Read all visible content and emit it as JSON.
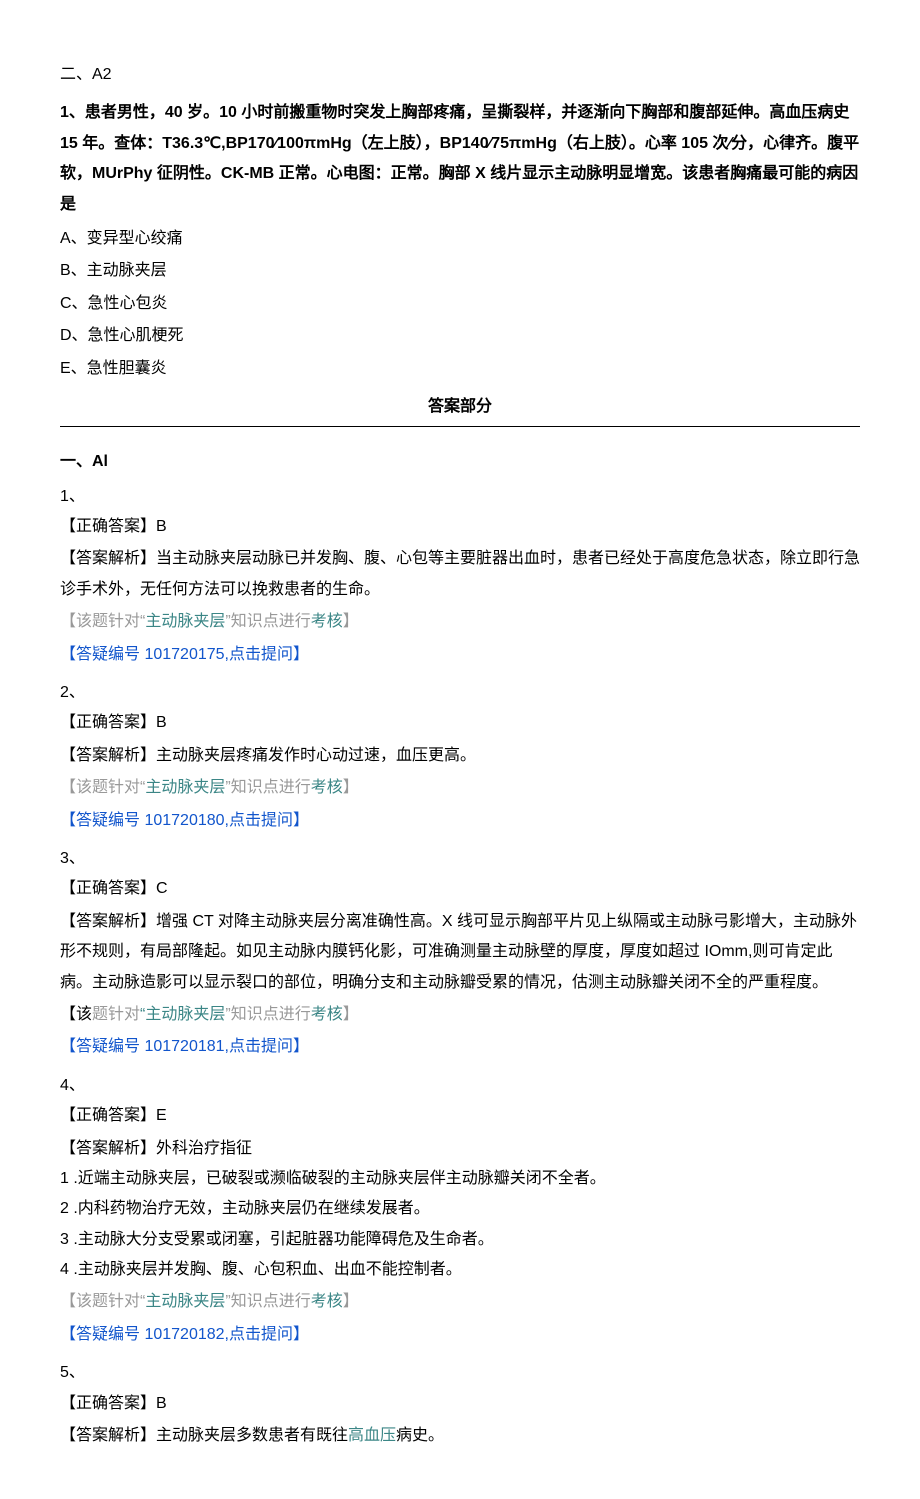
{
  "section2": {
    "header": "二、A2",
    "q1": {
      "num": "1、",
      "stem": "患者男性，40 岁。10 小时前搬重物时突发上胸部疼痛，呈撕裂样，并逐渐向下胸部和腹部延伸。高血压病史 15 年。查体：T36.3℃,BP170⁄100πmHg（左上肢），BP140⁄75πmHg（右上肢）。心率 105 次∕分，心律齐。腹平软，MUrPhy 征阴性。CK-MB 正常。心电图：正常。胸部 X 线片显示主动脉明显增宽。该患者胸痛最可能的病因是",
      "options": {
        "A": "A、变异型心绞痛",
        "B": "B、主动脉夹层",
        "C": "C、急性心包炎",
        "D": "D、急性心肌梗死",
        "E": "E、急性胆囊炎"
      }
    }
  },
  "answerTitle": "答案部分",
  "answerSection": {
    "header": "一、Al",
    "items": [
      {
        "num": "1、",
        "correct": "【正确答案】B",
        "explain": "【答案解析】当主动脉夹层动脉已并发胸、腹、心包等主要脏器出血时，患者已经处于高度危急状态，除立即行急诊手术外，无任何方法可以挽救患者的生命。",
        "topicPrefix": "【该题针对“",
        "topicTerm": "主动脉夹层",
        "topicSuffixA": "”知识点进行",
        "topicSuffixB": "考核",
        "topicClose": "】",
        "link": "【答疑编号 101720175,点击提问】"
      },
      {
        "num": "2、",
        "correct": "【正确答案】B",
        "explain": "【答案解析】主动脉夹层疼痛发作时心动过速，血压更高。",
        "topicPrefix": "【该题针对“",
        "topicTerm": "主动脉夹层",
        "topicSuffixA": "”知识点进行",
        "topicSuffixB": "考核",
        "topicClose": "】",
        "link": "【答疑编号 101720180,点击提问】"
      },
      {
        "num": "3、",
        "correct": "【正确答案】C",
        "explain": "【答案解析】增强 CT 对降主动脉夹层分离准确性高。X 线可显示胸部平片见上纵隔或主动脉弓影增大，主动脉外形不规则，有局部隆起。如见主动脉内膜钙化影，可准确测量主动脉壁的厚度，厚度如超过 IOmm,则可肯定此病。主动脉造影可以显示裂口的部位，明确分支和主动脉瓣受累的情况，估测主动脉瓣关闭不全的严重程度。",
        "topicA": "【该",
        "topicB": "题针对",
        "topicQuote": "“",
        "topicTerm": "主动脉夹层",
        "topicSuffixA": "”知识点进行",
        "topicSuffixB": "考核",
        "topicClose": "】",
        "link": "【答疑编号 101720181,点击提问】"
      },
      {
        "num": "4、",
        "correct": "【正确答案】E",
        "explain": "【答案解析】外科治疗指征",
        "bullets": [
          "1  .近端主动脉夹层，已破裂或濒临破裂的主动脉夹层伴主动脉瓣关闭不全者。",
          "2  .内科药物治疗无效，主动脉夹层仍在继续发展者。",
          "3  .主动脉大分支受累或闭塞，引起脏器功能障碍危及生命者。",
          "4  .主动脉夹层并发胸、腹、心包积血、出血不能控制者。"
        ],
        "topicPrefix": "【该题针对“",
        "topicTerm": "主动脉夹层",
        "topicSuffixA": "”知识点进行",
        "topicSuffixB": "考核",
        "topicClose": "】",
        "link": "【答疑编号 101720182,点击提问】"
      },
      {
        "num": "5、",
        "correct": "【正确答案】B",
        "explainA": "【答案解析】主动脉夹层多数患者有既往",
        "explainTerm": "高血压",
        "explainB": "病史。"
      }
    ]
  }
}
